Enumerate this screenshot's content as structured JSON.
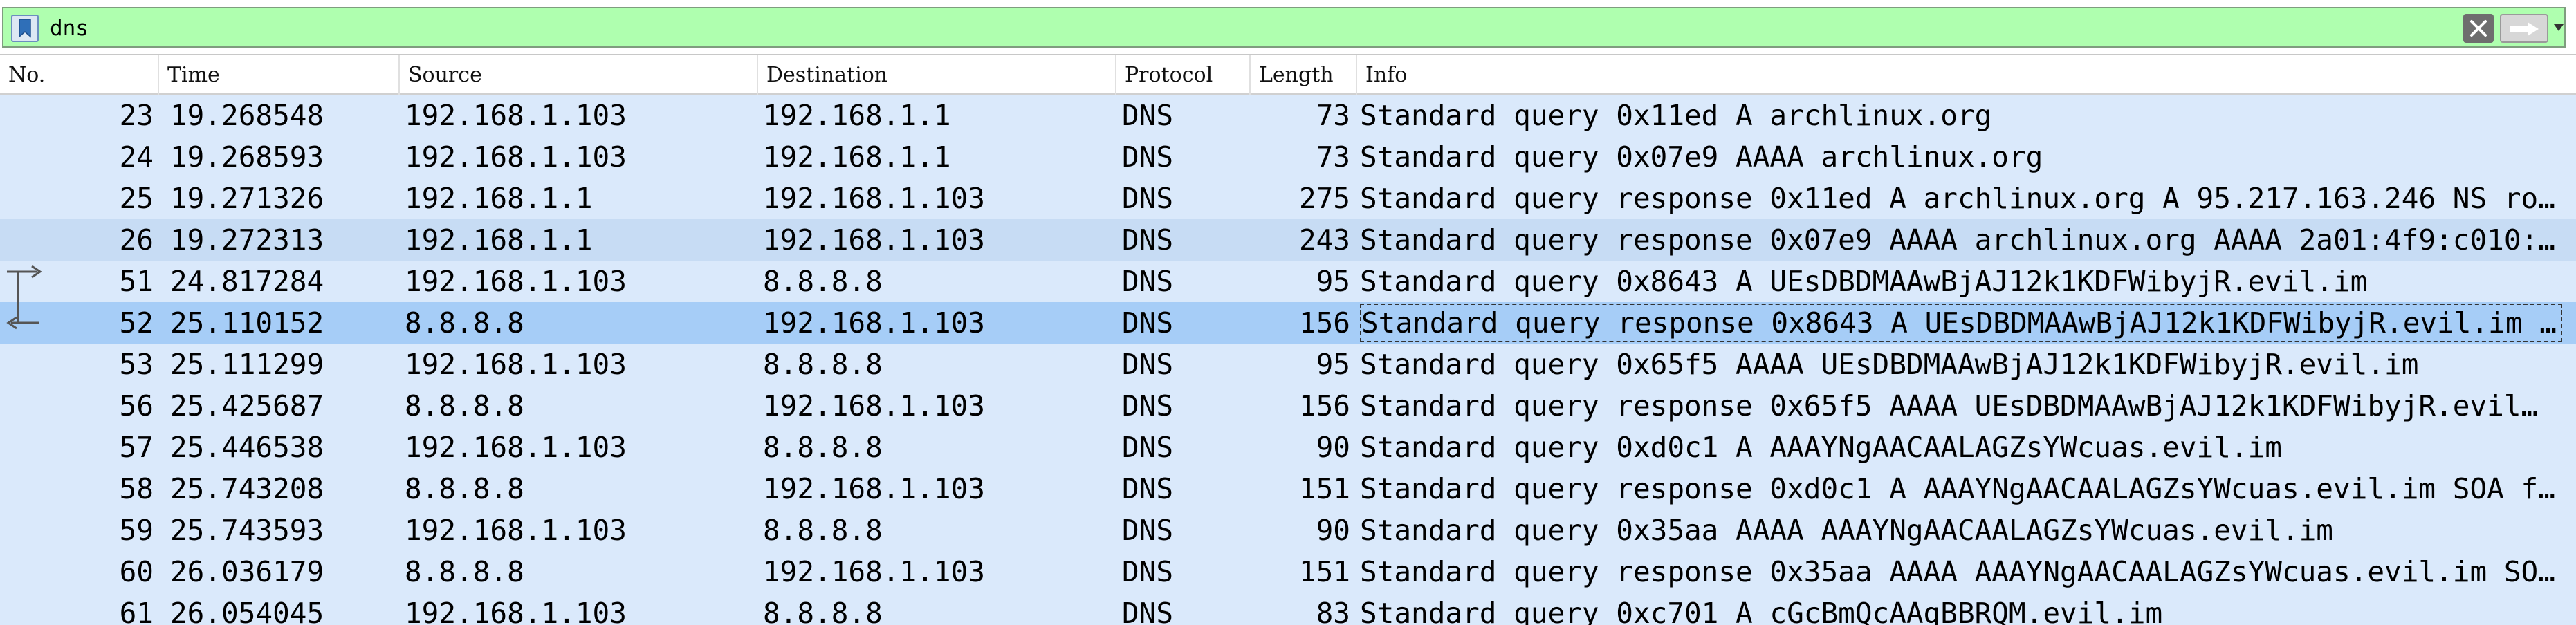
{
  "filter": {
    "value": "dns",
    "icons": {
      "bookmark": "bookmark-icon",
      "clear": "clear-x-icon",
      "apply": "arrow-right-icon",
      "dropdown": "triangle-down-icon"
    }
  },
  "columns": [
    "No.",
    "Time",
    "Source",
    "Destination",
    "Protocol",
    "Length",
    "Info"
  ],
  "packets": [
    {
      "no": "23",
      "time": "19.268548",
      "src": "192.168.1.103",
      "dst": "192.168.1.1",
      "proto": "DNS",
      "len": "73",
      "info": "Standard query 0x11ed A archlinux.org"
    },
    {
      "no": "24",
      "time": "19.268593",
      "src": "192.168.1.103",
      "dst": "192.168.1.1",
      "proto": "DNS",
      "len": "73",
      "info": "Standard query 0x07e9 AAAA archlinux.org"
    },
    {
      "no": "25",
      "time": "19.271326",
      "src": "192.168.1.1",
      "dst": "192.168.1.103",
      "proto": "DNS",
      "len": "275",
      "info": "Standard query response 0x11ed A archlinux.org A 95.217.163.246 NS ro…"
    },
    {
      "no": "26",
      "time": "19.272313",
      "src": "192.168.1.1",
      "dst": "192.168.1.103",
      "proto": "DNS",
      "len": "243",
      "info": "Standard query response 0x07e9 AAAA archlinux.org AAAA 2a01:4f9:c010:…"
    },
    {
      "no": "51",
      "time": "24.817284",
      "src": "192.168.1.103",
      "dst": "8.8.8.8",
      "proto": "DNS",
      "len": "95",
      "info": "Standard query 0x8643 A UEsDBDMAAwBjAJ12k1KDFWibyjR.evil.im"
    },
    {
      "no": "52",
      "time": "25.110152",
      "src": "8.8.8.8",
      "dst": "192.168.1.103",
      "proto": "DNS",
      "len": "156",
      "info": "Standard query response 0x8643 A UEsDBDMAAwBjAJ12k1KDFWibyjR.evil.im …"
    },
    {
      "no": "53",
      "time": "25.111299",
      "src": "192.168.1.103",
      "dst": "8.8.8.8",
      "proto": "DNS",
      "len": "95",
      "info": "Standard query 0x65f5 AAAA UEsDBDMAAwBjAJ12k1KDFWibyjR.evil.im"
    },
    {
      "no": "56",
      "time": "25.425687",
      "src": "8.8.8.8",
      "dst": "192.168.1.103",
      "proto": "DNS",
      "len": "156",
      "info": "Standard query response 0x65f5 AAAA UEsDBDMAAwBjAJ12k1KDFWibyjR.evil…"
    },
    {
      "no": "57",
      "time": "25.446538",
      "src": "192.168.1.103",
      "dst": "8.8.8.8",
      "proto": "DNS",
      "len": "90",
      "info": "Standard query 0xd0c1 A AAAYNgAACAALAGZsYWcuas.evil.im"
    },
    {
      "no": "58",
      "time": "25.743208",
      "src": "8.8.8.8",
      "dst": "192.168.1.103",
      "proto": "DNS",
      "len": "151",
      "info": "Standard query response 0xd0c1 A AAAYNgAACAALAGZsYWcuas.evil.im SOA f…"
    },
    {
      "no": "59",
      "time": "25.743593",
      "src": "192.168.1.103",
      "dst": "8.8.8.8",
      "proto": "DNS",
      "len": "90",
      "info": "Standard query 0x35aa AAAA AAAYNgAACAALAGZsYWcuas.evil.im"
    },
    {
      "no": "60",
      "time": "26.036179",
      "src": "8.8.8.8",
      "dst": "192.168.1.103",
      "proto": "DNS",
      "len": "151",
      "info": "Standard query response 0x35aa AAAA AAAYNgAACAALAGZsYWcuas.evil.im SO…"
    },
    {
      "no": "61",
      "time": "26.054045",
      "src": "192.168.1.103",
      "dst": "8.8.8.8",
      "proto": "DNS",
      "len": "83",
      "info": "Standard query 0xc701 A cGcBmQcAAgBBRQM.evil.im"
    }
  ],
  "selected_packet": "52",
  "related_packet": "51",
  "colors": {
    "filter_valid": "#afffaf",
    "row": "#dae9fb",
    "selected": "#a6cdf7"
  }
}
